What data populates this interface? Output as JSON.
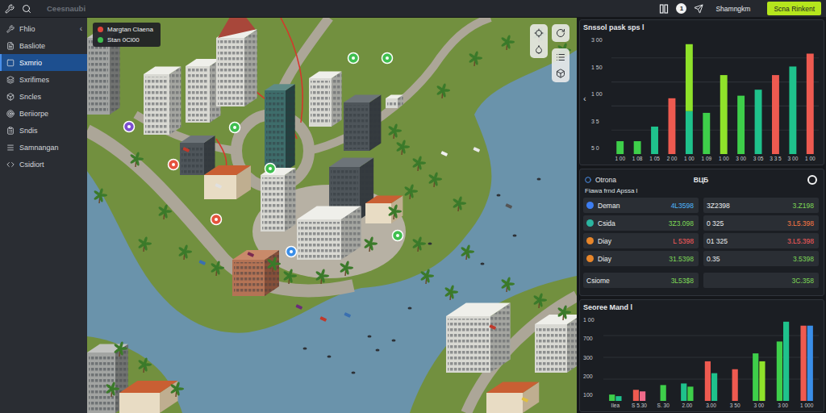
{
  "app": {
    "title": "Ceesnaubi"
  },
  "topbar": {
    "badge": "1",
    "user": "Shamngkm",
    "button": "Scna Rinkent"
  },
  "sidebar": {
    "collapse": "‹",
    "items": [
      {
        "label": "Fhlio",
        "selected": false
      },
      {
        "label": "Basliote",
        "selected": false
      },
      {
        "label": "Sxmrio",
        "selected": true
      },
      {
        "label": "Sxrifimes",
        "selected": false
      },
      {
        "label": "Sncles",
        "selected": false
      },
      {
        "label": "Beriiorpe",
        "selected": false
      },
      {
        "label": "Sndis",
        "selected": false
      },
      {
        "label": "Samnangan",
        "selected": false
      },
      {
        "label": "Csidiort",
        "selected": false
      }
    ]
  },
  "map": {
    "legend": [
      {
        "label": "Margtan Claena",
        "color": "#e0463c"
      },
      {
        "label": "Stan 0Cl00",
        "color": "#3fbf4f"
      }
    ]
  },
  "chart_top": {
    "title": "Snssol pask sps l",
    "nav": "‹",
    "max": 140,
    "y_ticks": [
      "3 00",
      "1 50",
      "1 00",
      "3 5",
      "5 0"
    ],
    "x_labels": [
      "1 00",
      "1 08",
      "1 05",
      "2 00",
      "1 00",
      "1 09",
      "1 00",
      "3 00",
      "3 05",
      "3 3 5",
      "3 00",
      "1 00"
    ],
    "bars": [
      {
        "stack": [
          {
            "value": 15,
            "color": "#3ecf4a"
          }
        ]
      },
      {
        "stack": [
          {
            "value": 15,
            "color": "#3ecf4a"
          }
        ]
      },
      {
        "stack": [
          {
            "value": 32,
            "color": "#1fc28c"
          }
        ]
      },
      {
        "stack": [
          {
            "value": 65,
            "color": "#ee5a50"
          }
        ]
      },
      {
        "stack": [
          {
            "value": 50,
            "color": "#1fc28c"
          },
          {
            "value": 78,
            "color": "#8fe22a"
          }
        ]
      },
      {
        "stack": [
          {
            "value": 48,
            "color": "#3ecf4a"
          }
        ]
      },
      {
        "stack": [
          {
            "value": 92,
            "color": "#8fe22a"
          }
        ]
      },
      {
        "stack": [
          {
            "value": 68,
            "color": "#3ecf4a"
          }
        ]
      },
      {
        "stack": [
          {
            "value": 75,
            "color": "#1fc28c"
          }
        ]
      },
      {
        "stack": [
          {
            "value": 92,
            "color": "#ee5a50"
          }
        ]
      },
      {
        "stack": [
          {
            "value": 102,
            "color": "#1fc28c"
          }
        ]
      },
      {
        "stack": [
          {
            "value": 117,
            "color": "#ee5a50"
          }
        ]
      }
    ]
  },
  "table": {
    "title": "Otrona",
    "code": "BЦБ",
    "subtitle": "Fiawa frnd Apssa l",
    "rows": [
      {
        "name": "Deman",
        "icon_color": "#3d7df0",
        "a": "4L3598",
        "a_color": "#4fb8ff",
        "b": "3Z2398",
        "c": "3.Z198",
        "c_color": "#7ed957"
      },
      {
        "name": "Csida",
        "icon_color": "#2bb5a0",
        "a": "3Z3.098",
        "a_color": "#7ed957",
        "b": "0 325",
        "c": "3.L5.398",
        "c_color": "#ff7a45"
      },
      {
        "name": "Diay",
        "icon_color": "#e8862a",
        "a": "L 5398",
        "a_color": "#ff5c5c",
        "b": "01 325",
        "c": "3.L5.398",
        "c_color": "#ff5c5c"
      },
      {
        "name": "Diay",
        "icon_color": "#e8862a",
        "a": "31.5398",
        "a_color": "#7ed957",
        "b": "0.35",
        "c": "3.5398",
        "c_color": "#7ed957"
      }
    ],
    "total": {
      "name": "Csiome",
      "a": "3L53$8",
      "a_color": "#7ed957",
      "b": "3C.358",
      "b_color": "#7ed957"
    }
  },
  "chart_bottom": {
    "title": "Seoree Mand l",
    "max": 110,
    "y_ticks": [
      "1 00",
      "700",
      "300",
      "200",
      "100"
    ],
    "x_labels": [
      "Ilea",
      "S 5.30",
      "S. 30",
      "2.00",
      "3.00",
      "3 50",
      "3 00",
      "3 00",
      "1 000"
    ],
    "groups": [
      {
        "bars": [
          {
            "value": 8,
            "color": "#3ecf4a"
          },
          {
            "value": 6,
            "color": "#1fc28c"
          }
        ]
      },
      {
        "bars": [
          {
            "value": 14,
            "color": "#ee5a50"
          },
          {
            "value": 12,
            "color": "#f06a8a"
          }
        ]
      },
      {
        "bars": [
          {
            "value": 20,
            "color": "#3ecf4a"
          }
        ]
      },
      {
        "bars": [
          {
            "value": 22,
            "color": "#1fc28c"
          },
          {
            "value": 18,
            "color": "#3ecf4a"
          }
        ]
      },
      {
        "bars": [
          {
            "value": 50,
            "color": "#ee5a50"
          },
          {
            "value": 35,
            "color": "#1fc28c"
          }
        ]
      },
      {
        "bars": [
          {
            "value": 40,
            "color": "#ee5a50"
          }
        ]
      },
      {
        "bars": [
          {
            "value": 60,
            "color": "#3ecf4a"
          },
          {
            "value": 50,
            "color": "#8fe22a"
          }
        ]
      },
      {
        "bars": [
          {
            "value": 75,
            "color": "#3ecf4a"
          },
          {
            "value": 100,
            "color": "#1fc28c"
          }
        ]
      },
      {
        "bars": [
          {
            "value": 95,
            "color": "#ee5a50"
          },
          {
            "value": 95,
            "color": "#3a8ee8"
          }
        ]
      }
    ]
  }
}
